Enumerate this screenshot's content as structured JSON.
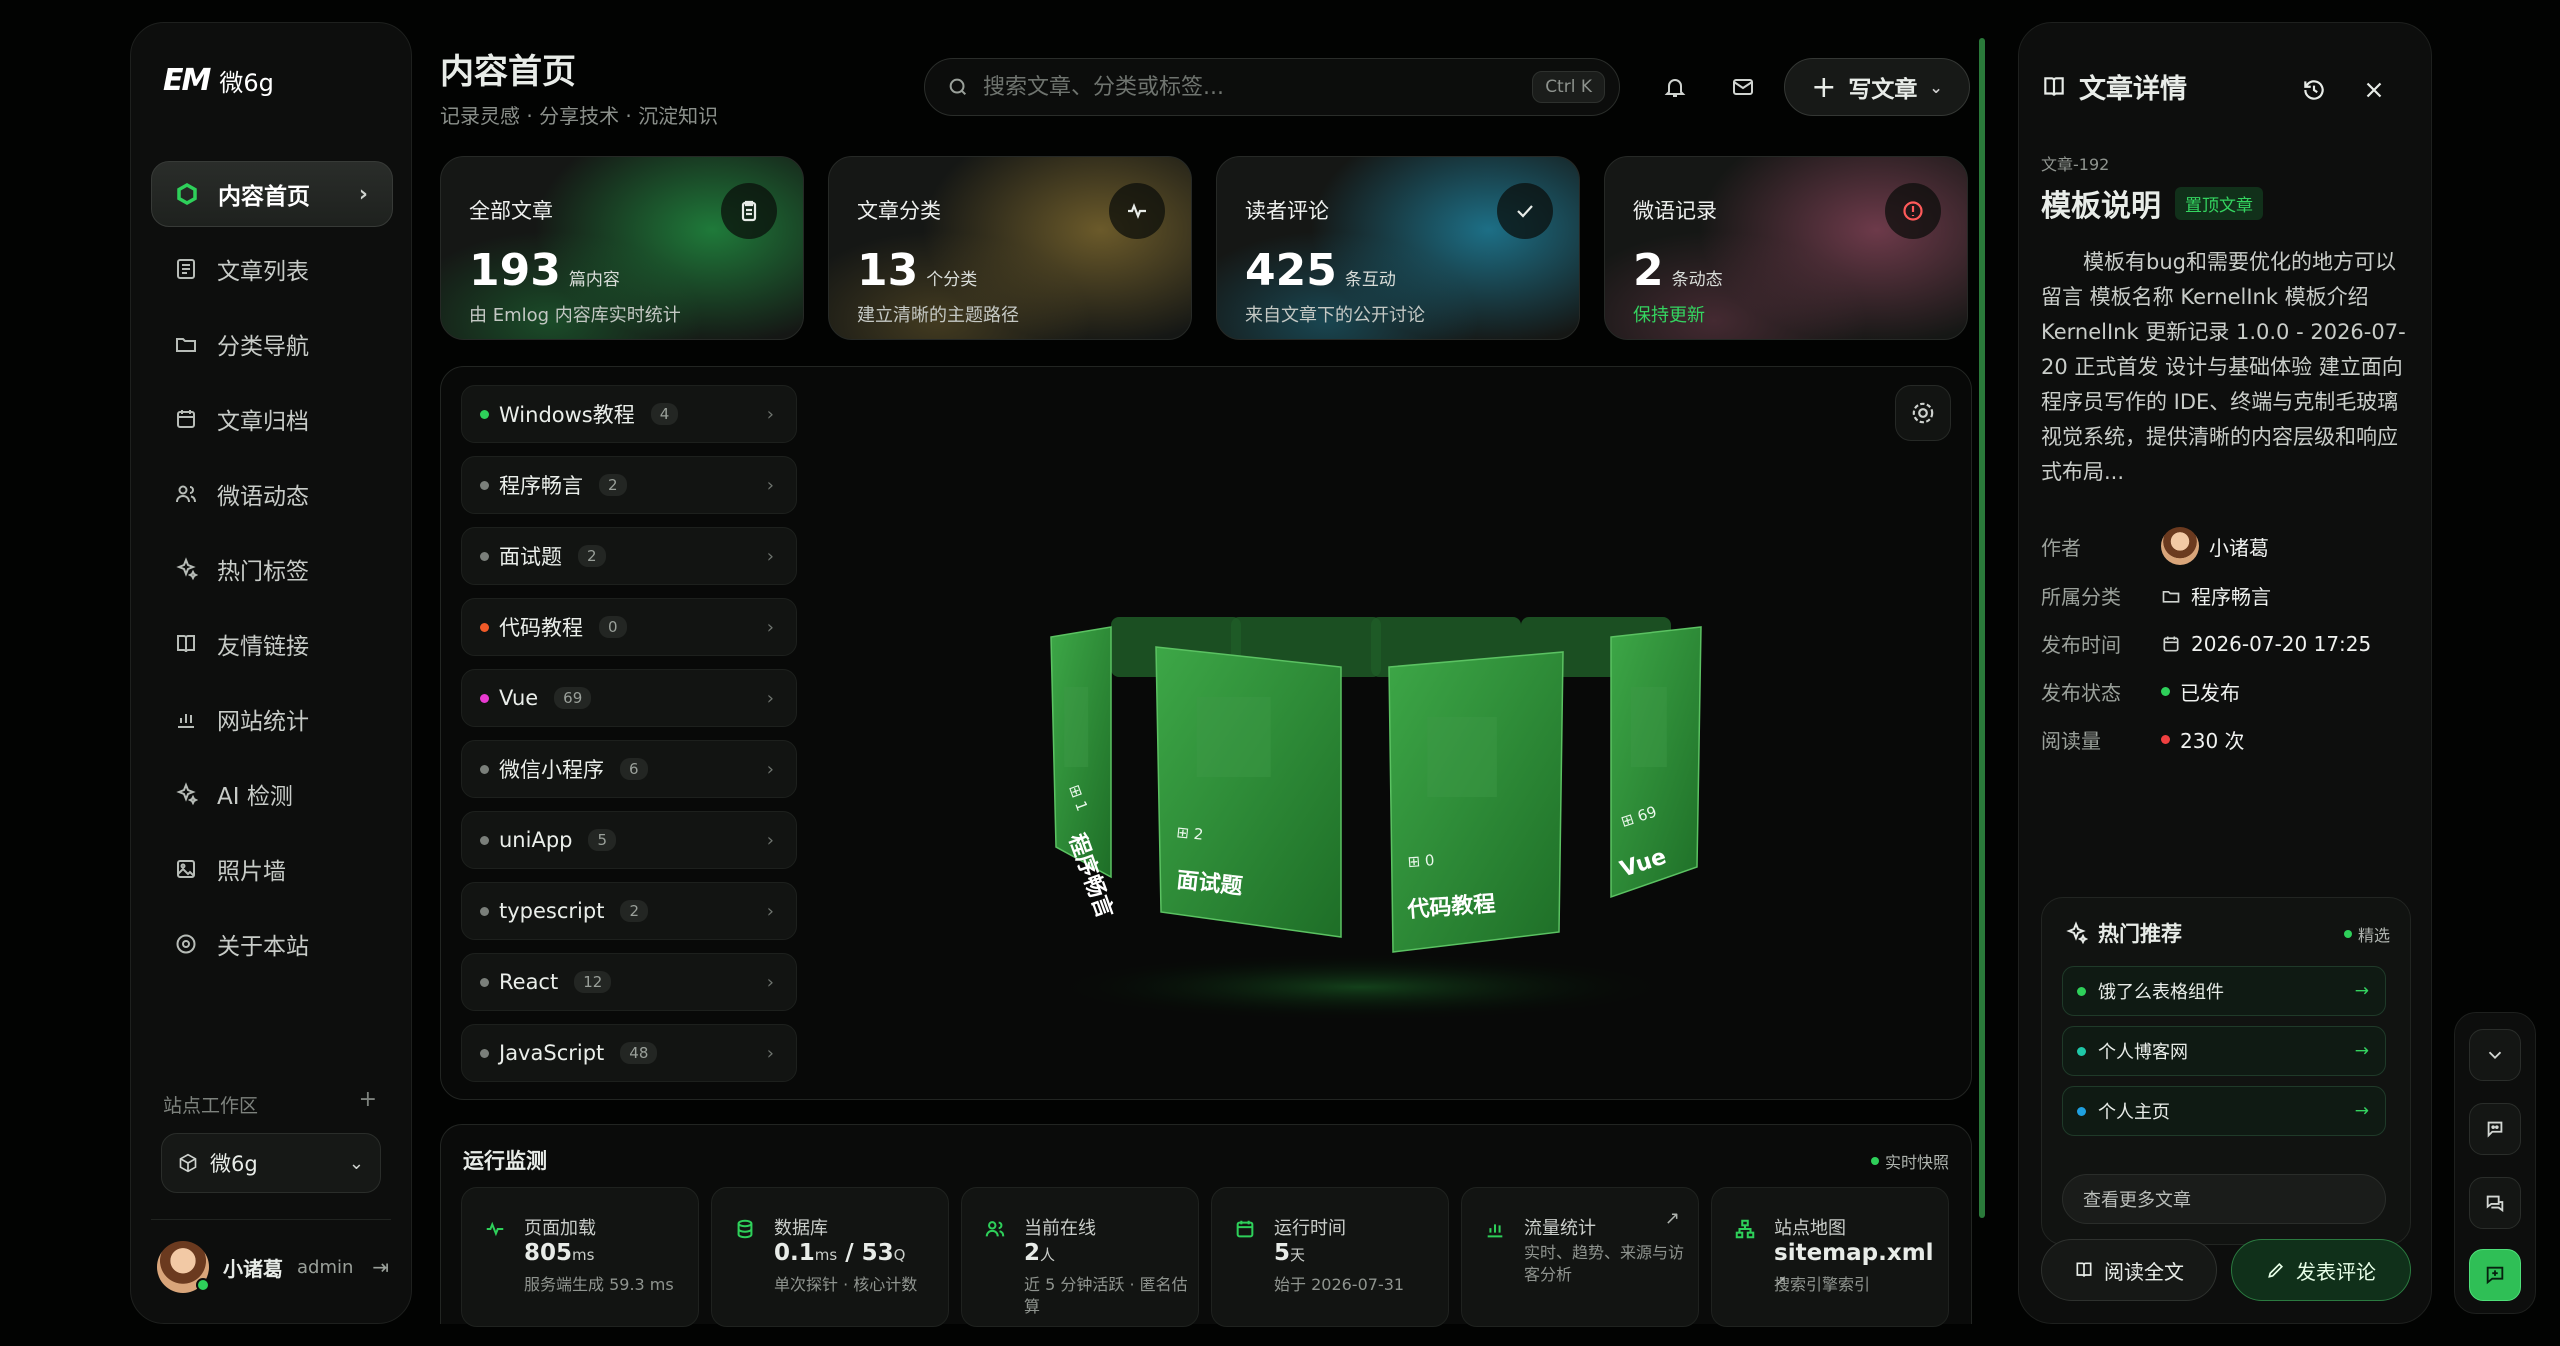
{
  "sidebar": {
    "logo": "EM",
    "site_name": "微6g",
    "nav": [
      {
        "label": "内容首页",
        "icon": "hexagon-icon",
        "active": true
      },
      {
        "label": "文章列表",
        "icon": "article-list-icon"
      },
      {
        "label": "分类导航",
        "icon": "folder-icon"
      },
      {
        "label": "文章归档",
        "icon": "calendar-icon"
      },
      {
        "label": "微语动态",
        "icon": "users-icon"
      },
      {
        "label": "热门标签",
        "icon": "sparkles-icon"
      },
      {
        "label": "友情链接",
        "icon": "book-icon"
      },
      {
        "label": "网站统计",
        "icon": "bar-chart-icon"
      },
      {
        "label": "AI 检测",
        "icon": "sparkles-icon"
      },
      {
        "label": "照片墙",
        "icon": "image-icon"
      },
      {
        "label": "关于本站",
        "icon": "settings-icon"
      }
    ],
    "workspace_label": "站点工作区",
    "workspace_add": "+",
    "workspace_selected": "微6g",
    "user": {
      "name": "小诸葛",
      "role": "admin"
    }
  },
  "header": {
    "title": "内容首页",
    "subtitle": "记录灵感 · 分享技术 · 沉淀知识",
    "search_placeholder": "搜索文章、分类或标签...",
    "search_shortcut": "Ctrl K",
    "write_label": "写文章"
  },
  "stats": [
    {
      "label": "全部文章",
      "value": "193",
      "unit": "篇内容",
      "desc": "由 Emlog 内容库实时统计",
      "icon": "clipboard-icon",
      "accent": "#1f7a3a"
    },
    {
      "label": "文章分类",
      "value": "13",
      "unit": "个分类",
      "desc": "建立清晰的主题路径",
      "icon": "pulse-icon",
      "accent": "#6b5a2a"
    },
    {
      "label": "读者评论",
      "value": "425",
      "unit": "条互动",
      "desc": "来自文章下的公开讨论",
      "icon": "check-icon",
      "accent": "#1d6f86"
    },
    {
      "label": "微语记录",
      "value": "2",
      "unit": "条动态",
      "desc": "保持更新",
      "icon": "alert-icon",
      "accent": "#6d3a4a"
    }
  ],
  "categories": [
    {
      "name": "Windows教程",
      "count": "4",
      "color": "#2ed05a"
    },
    {
      "name": "程序畅言",
      "count": "2",
      "color": "#7a7f7a"
    },
    {
      "name": "面试题",
      "count": "2",
      "color": "#7a7f7a"
    },
    {
      "name": "代码教程",
      "count": "0",
      "color": "#f05a28"
    },
    {
      "name": "Vue",
      "count": "69",
      "color": "#e83ad0"
    },
    {
      "name": "微信小程序",
      "count": "6",
      "color": "#7a7f7a"
    },
    {
      "name": "uniApp",
      "count": "5",
      "color": "#7a7f7a"
    },
    {
      "name": "typescript",
      "count": "2",
      "color": "#7a7f7a"
    },
    {
      "name": "React",
      "count": "12",
      "color": "#7a7f7a"
    },
    {
      "name": "JavaScript",
      "count": "48",
      "color": "#7a7f7a"
    }
  ],
  "carousel": {
    "cards": [
      {
        "name": "程序畅言",
        "count": "1"
      },
      {
        "name": "面试题",
        "count": "2"
      },
      {
        "name": "代码教程",
        "count": "0"
      },
      {
        "name": "Vue",
        "count": "69"
      }
    ],
    "color": "#2e8a36"
  },
  "monitor": {
    "title": "运行监测",
    "live_label": "实时快照",
    "metrics": [
      {
        "label": "页面加载",
        "value": "805",
        "unit": "ms",
        "sub": "服务端生成 59.3 ms",
        "icon": "pulse-icon"
      },
      {
        "label": "数据库",
        "value": "0.1",
        "unit": "ms",
        "value2": "53",
        "unit2": "Q",
        "sub": "单次探针 · 核心计数",
        "icon": "database-icon"
      },
      {
        "label": "当前在线",
        "value": "2",
        "unit": "人",
        "sub": "近 5 分钟活跃 · 匿名估算",
        "icon": "users-icon"
      },
      {
        "label": "运行时间",
        "value": "5",
        "unit": "天",
        "sub": "始于 2026-07-31",
        "icon": "calendar-icon"
      },
      {
        "label": "流量统计",
        "value": "",
        "unit": "",
        "sub": "实时、趋势、来源与访客分析",
        "icon": "bar-chart-icon",
        "arrow": "↗"
      },
      {
        "label": "站点地图",
        "value": "sitemap.xml",
        "unit": "",
        "sub": "搜索引擎索引",
        "icon": "sitemap-icon",
        "arrow": "↗"
      }
    ]
  },
  "detail": {
    "title": "文章详情",
    "article_id": "文章-192",
    "heading": "模板说明",
    "pin_label": "置顶文章",
    "body": "模板有bug和需要优化的地方可以留言 模板名称 KernelInk 模板介绍 KernelInk 更新记录 1.0.0 - 2026-07-20 正式首发 设计与基础体验 建立面向程序员写作的 IDE、终端与克制毛玻璃视觉系统，提供清晰的内容层级和响应式布局...",
    "meta": [
      {
        "key": "作者",
        "value": "小诸葛",
        "type": "avatar"
      },
      {
        "key": "所属分类",
        "value": "程序畅言",
        "type": "folder-icon"
      },
      {
        "key": "发布时间",
        "value": "2026-07-20 17:25",
        "type": "calendar-icon"
      },
      {
        "key": "发布状态",
        "value": "已发布",
        "type": "dot",
        "color": "#2ed05a"
      },
      {
        "key": "阅读量",
        "value": "230 次",
        "type": "dot",
        "color": "#f04040"
      }
    ],
    "hot": {
      "title": "热门推荐",
      "tag": "精选",
      "items": [
        {
          "label": "饿了么表格组件",
          "color": "#2ed05a"
        },
        {
          "label": "个人博客网",
          "color": "#1fc8a8"
        },
        {
          "label": "个人主页",
          "color": "#1fa0e0"
        }
      ],
      "more": "查看更多文章"
    },
    "read_label": "阅读全文",
    "comment_label": "发表评论"
  }
}
